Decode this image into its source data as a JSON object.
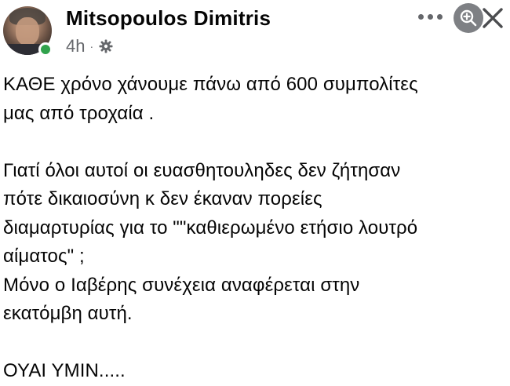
{
  "post": {
    "author": {
      "name": "Mitsopoulos Dimitris",
      "avatar_icon": "profile-photo",
      "online_status": "online",
      "online_color": "#31a24c"
    },
    "timestamp": "4h",
    "separator": "·",
    "audience_icon": "gear-icon",
    "body": {
      "paragraph_1": [
        "ΚΑΘΕ χρόνο χάνουμε πάνω από 600 συμπολίτες",
        "μας από τροχαία ."
      ],
      "paragraph_2": [
        "Γιατί όλοι αυτοί οι ευασθητουληδες δεν ζήτησαν",
        "πότε δικαιοσύνη κ δεν έκαναν πορείες",
        "διαμαρτυρίας για το \"\"καθιερωμένο ετήσιο λουτρό",
        "αίματος\" ;",
        "Μόνο ο Ιαβέρης συνέχεια αναφέρεται στην",
        "εκατόμβη αυτή."
      ],
      "paragraph_3": [
        "ΟΥΑΙ ΥΜΙΝ....."
      ]
    }
  },
  "toolbar": {
    "more_icon": "more-horizontal-icon",
    "zoom_icon": "zoom-in-icon",
    "close_icon": "close-icon"
  },
  "colors": {
    "text": "#050505",
    "secondary_text": "#65676b",
    "zoom_button_bg": "#7e8084"
  }
}
